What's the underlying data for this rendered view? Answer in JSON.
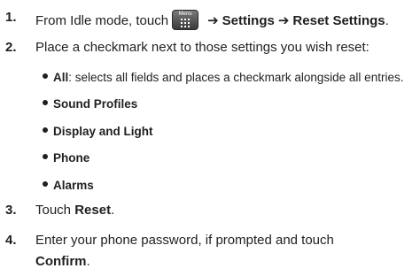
{
  "steps": [
    {
      "number": "1.",
      "pre": "From Idle mode, touch",
      "icon_label": "Menu",
      "arrow": "➔",
      "bold_1": "Settings",
      "bold_2": "Reset Settings",
      "end": "."
    },
    {
      "number": "2.",
      "text": "Place a checkmark next to those settings you wish reset:"
    },
    {
      "number": "3.",
      "pre": "Touch",
      "bold": "Reset",
      "end": "."
    },
    {
      "number": "4.",
      "line1": "Enter your phone password, if prompted and touch",
      "bold": "Confirm",
      "end": "."
    }
  ],
  "bullets": [
    {
      "label": "All",
      "desc": ": selects all fields and places a checkmark alongside all entries."
    },
    {
      "label": "Sound Profiles"
    },
    {
      "label": "Display and Light"
    },
    {
      "label": "Phone"
    },
    {
      "label": "Alarms"
    }
  ],
  "icons": {
    "menu": "menu-grid-icon"
  }
}
